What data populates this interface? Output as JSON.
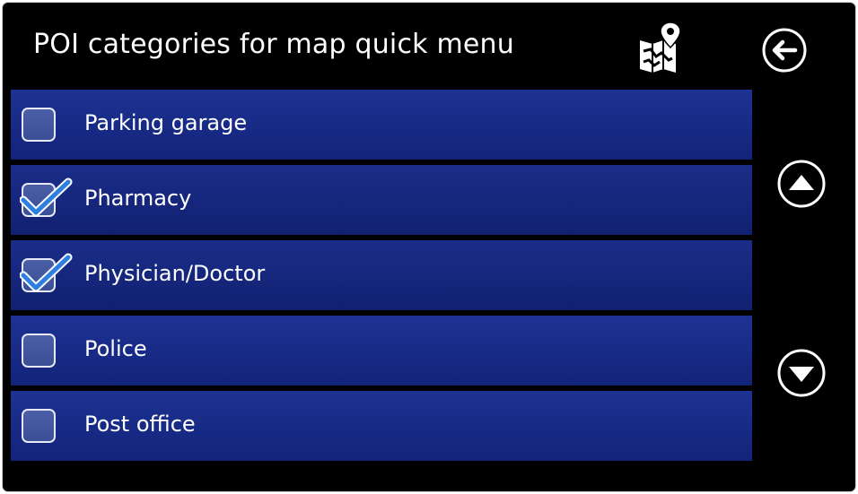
{
  "header": {
    "title": "POI categories for map quick menu",
    "map_icon": "map-pin-icon",
    "back_icon": "back-arrow-icon"
  },
  "categories": [
    {
      "label": "Parking garage",
      "checked": false
    },
    {
      "label": "Pharmacy",
      "checked": true
    },
    {
      "label": "Physician/Doctor",
      "checked": true
    },
    {
      "label": "Police",
      "checked": false
    },
    {
      "label": "Post office",
      "checked": false
    }
  ],
  "scroll": {
    "up_icon": "chevron-up-icon",
    "down_icon": "chevron-down-icon"
  },
  "colors": {
    "background": "#000000",
    "row": "#1a2e8c",
    "checkbox_fill": "#3f539a",
    "check_mark": "#2f7fe0",
    "text": "#ffffff"
  }
}
